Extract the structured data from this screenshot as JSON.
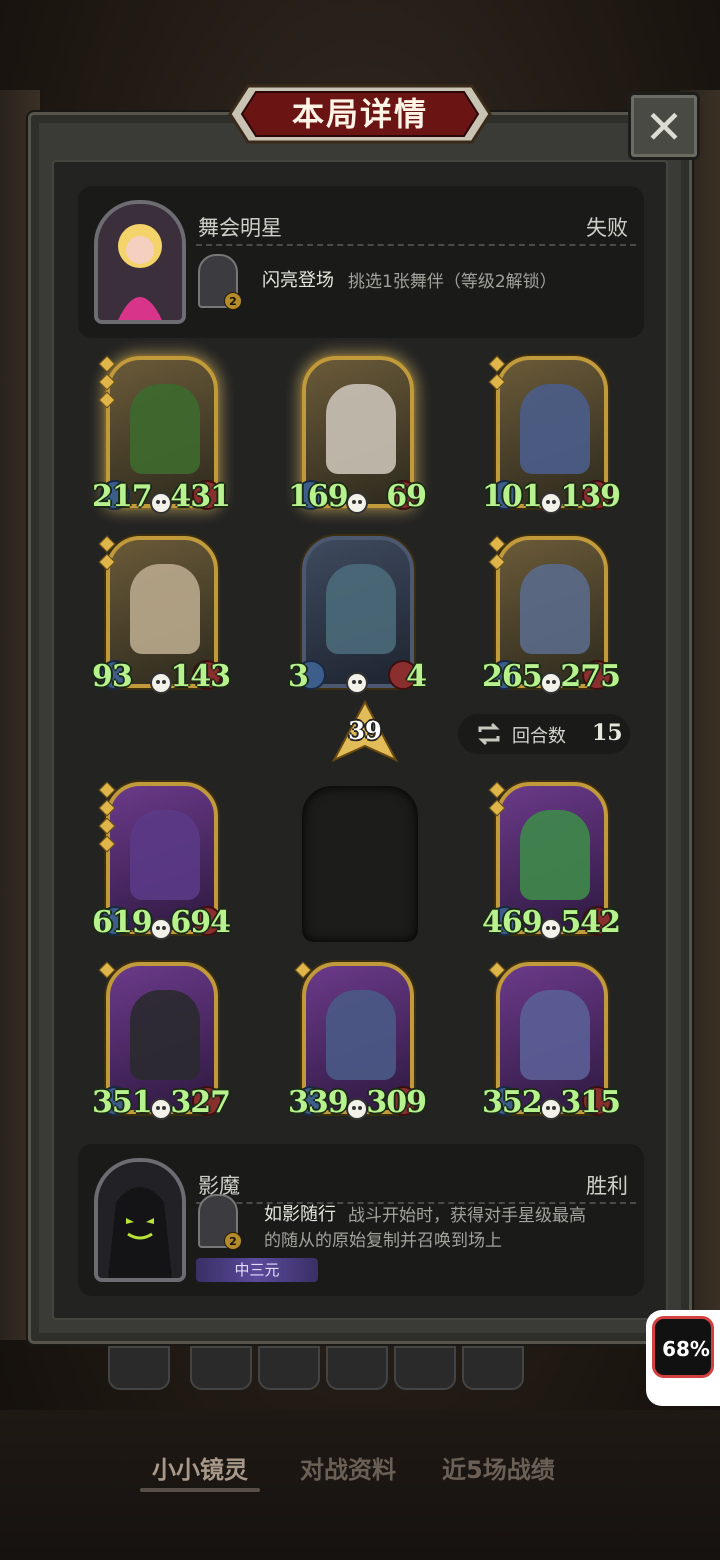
{
  "title": "本局详情",
  "close_glyph": "✕",
  "player_top": {
    "name": "舞会明星",
    "result": "失败",
    "skill_level": "2",
    "skill_name": "闪亮登场",
    "skill_desc": "挑选1张舞伴（等级2解锁）"
  },
  "player_bottom": {
    "name": "影魔",
    "result": "胜利",
    "skill_level": "2",
    "skill_name": "如影随行",
    "skill_desc_line1": "战斗开始时，获得对手星级最高",
    "skill_desc_line2": "的随从的原始复制并召唤到场上",
    "tag": "中三元"
  },
  "tier": "39",
  "rounds": {
    "label": "回合数",
    "value": "15"
  },
  "top_board": [
    {
      "atk": "217",
      "hp": "431",
      "stars": 3,
      "art_color": "#3d6a2e"
    },
    {
      "atk": "169",
      "hp": "69",
      "stars": 0,
      "art_color": "#c9c2b6"
    },
    {
      "atk": "101",
      "hp": "139",
      "stars": 2,
      "art_color": "#4a5d8a"
    },
    {
      "atk": "93",
      "hp": "143",
      "stars": 2,
      "art_color": "#b9a98c"
    },
    {
      "atk": "3",
      "hp": "4",
      "stars": 0,
      "art_color": "#4b6a7a"
    },
    {
      "atk": "265",
      "hp": "275",
      "stars": 2,
      "art_color": "#5a6a8a"
    }
  ],
  "bottom_board": [
    {
      "atk": "619",
      "hp": "694",
      "stars": 4,
      "art_color": "#5b3a86"
    },
    {
      "atk": "469",
      "hp": "542",
      "stars": 2,
      "art_color": "#3e8a4a"
    },
    {
      "atk": "351",
      "hp": "327",
      "stars": 1,
      "art_color": "#2a2a2f"
    },
    {
      "atk": "339",
      "hp": "309",
      "stars": 1,
      "art_color": "#4a5a86"
    },
    {
      "atk": "352",
      "hp": "315",
      "stars": 1,
      "art_color": "#5a5f96"
    }
  ],
  "tabs": [
    "小小镜灵",
    "对战资料",
    "近5场战绩"
  ],
  "battery": "68%"
}
